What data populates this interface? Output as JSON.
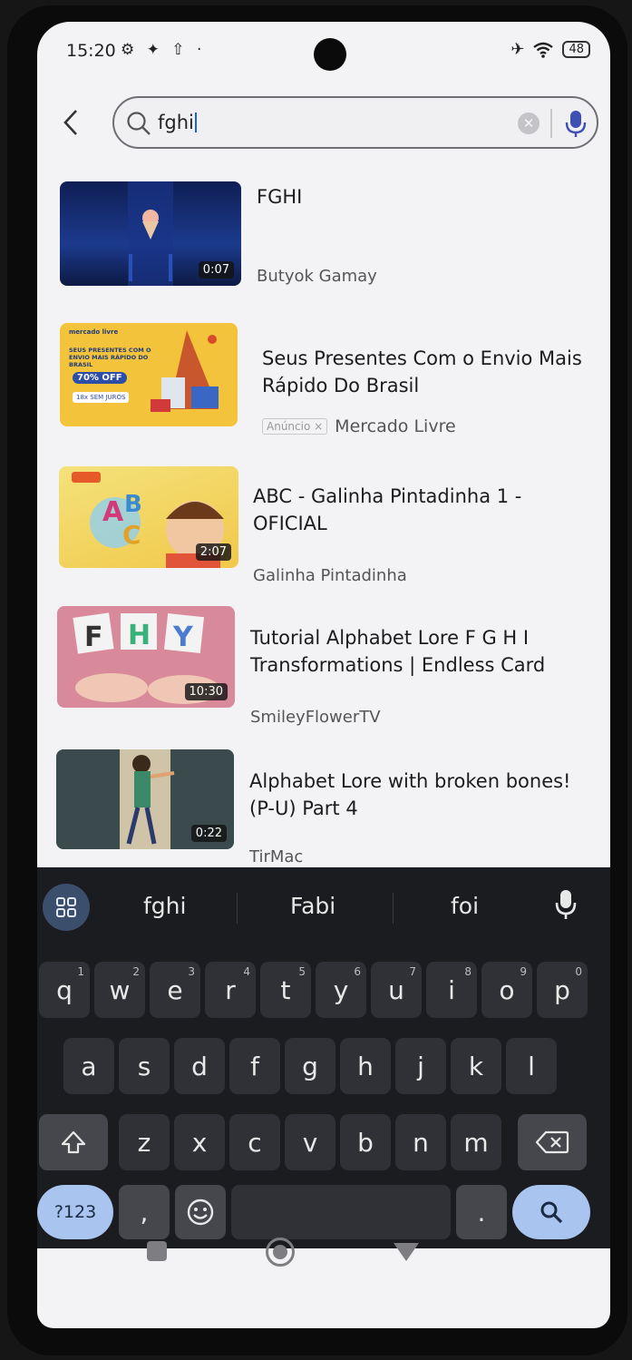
{
  "status": {
    "time": "15:20",
    "left_icons": "⚙ ✦ ⇧ ·",
    "battery": "48"
  },
  "search": {
    "query": "fghi"
  },
  "results": [
    {
      "title": "FGHI",
      "channel": "Butyok Gamay",
      "duration": "0:07"
    },
    {
      "title": "Seus Presentes Com o Envio Mais Rápido Do Brasil",
      "channel": "Mercado Livre",
      "ad_label": "Anúncio ×",
      "ad_art": {
        "brand": "mercado livre",
        "headline": "SEUS PRESENTES COM O ENVIO MAIS RÁPIDO DO BRASIL",
        "offer": "70% OFF",
        "installments": "18x SEM JUROS"
      }
    },
    {
      "title": "ABC - Galinha Pintadinha 1 - OFICIAL",
      "channel": "Galinha Pintadinha",
      "duration": "2:07"
    },
    {
      "title": "Tutorial Alphabet Lore F G H I Transformations | Endless Card",
      "channel": "SmileyFlowerTV",
      "duration": "10:30"
    },
    {
      "title": "Alphabet Lore with broken bones! (P-U) Part 4",
      "channel": "TirMac",
      "duration": "0:22"
    }
  ],
  "keyboard": {
    "suggestions": [
      "fghi",
      "Fabi",
      "foi"
    ],
    "row1": [
      {
        "k": "q",
        "h": "1"
      },
      {
        "k": "w",
        "h": "2"
      },
      {
        "k": "e",
        "h": "3"
      },
      {
        "k": "r",
        "h": "4"
      },
      {
        "k": "t",
        "h": "5"
      },
      {
        "k": "y",
        "h": "6"
      },
      {
        "k": "u",
        "h": "7"
      },
      {
        "k": "i",
        "h": "8"
      },
      {
        "k": "o",
        "h": "9"
      },
      {
        "k": "p",
        "h": "0"
      }
    ],
    "row2": [
      "a",
      "s",
      "d",
      "f",
      "g",
      "h",
      "j",
      "k",
      "l"
    ],
    "row3": [
      "z",
      "x",
      "c",
      "v",
      "b",
      "n",
      "m"
    ],
    "symbols_label": "?123",
    "comma": ",",
    "period": "."
  },
  "colors": {
    "accent": "#a9c4ef",
    "keyboard_bg": "#1b1c1f",
    "key_bg": "#2f3136"
  }
}
